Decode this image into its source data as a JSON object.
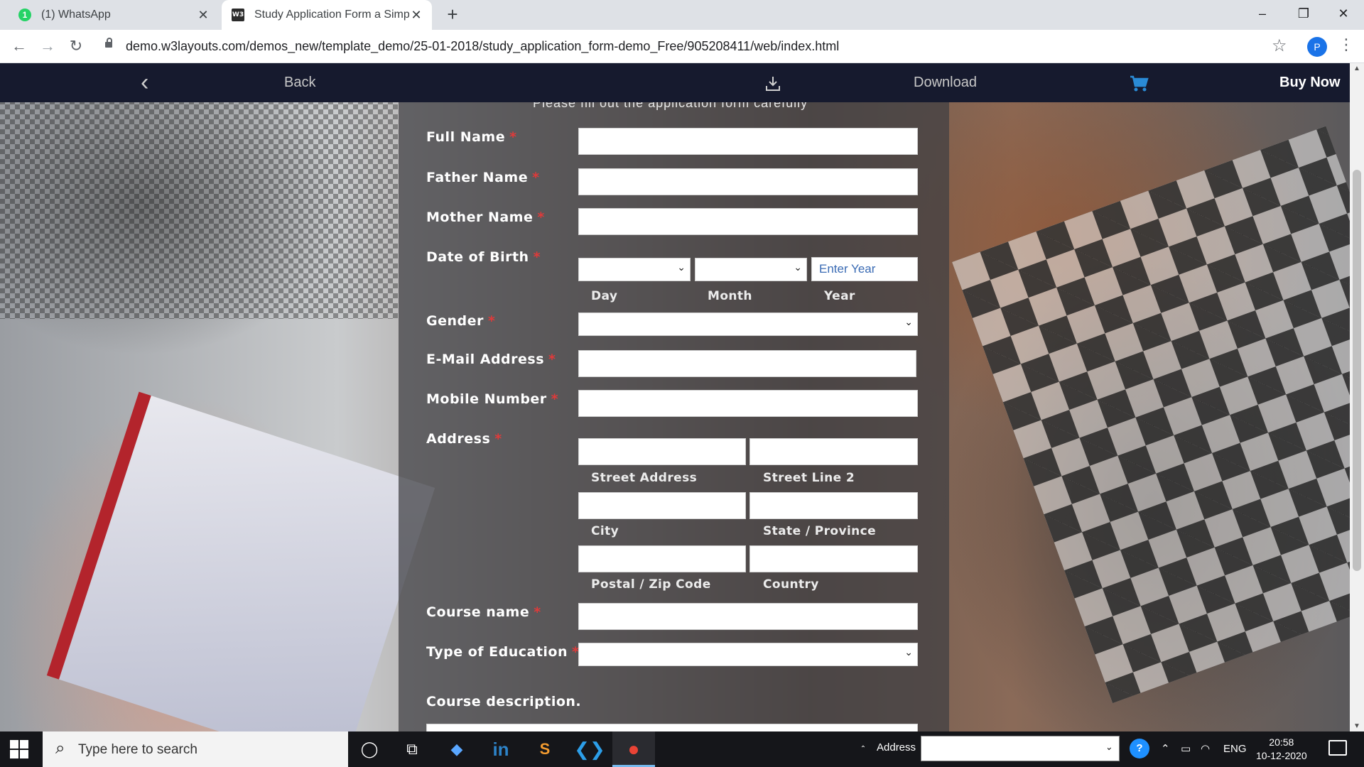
{
  "browser": {
    "tabs": [
      {
        "title": "(1) WhatsApp",
        "icon": "whatsapp-icon",
        "badge": "1"
      },
      {
        "title": "Study Application Form a Simple",
        "icon": "w3layouts-icon",
        "badge": "W3"
      }
    ],
    "new_tab": "+",
    "url": "demo.w3layouts.com/demos_new/template_demo/25-01-2018/study_application_form-demo_Free/905208411/web/index.html",
    "profile_initial": "P"
  },
  "topbar": {
    "back_label": "Back",
    "download_label": "Download",
    "buy_label": "Buy Now"
  },
  "form": {
    "cut_heading": "Please fill out the application form carefully",
    "full_name": "Full Name",
    "father_name": "Father Name",
    "mother_name": "Mother Name",
    "dob": "Date of Birth",
    "year_placeholder": "Enter Year",
    "day": "Day",
    "month": "Month",
    "year": "Year",
    "gender": "Gender",
    "email": "E-Mail Address",
    "mobile": "Mobile Number",
    "address": "Address",
    "street": "Street Address",
    "street2": "Street Line 2",
    "city": "City",
    "state": "State / Province",
    "postal": "Postal / Zip Code",
    "country": "Country",
    "course_name": "Course name",
    "education_type": "Type of Education",
    "course_desc": "Course description.",
    "required_mark": "*"
  },
  "taskbar": {
    "search_placeholder": "Type here to search",
    "address_label": "Address",
    "language": "ENG",
    "time": "20:58",
    "date": "10-12-2020"
  },
  "colors": {
    "topbar_bg": "#161a2e",
    "required": "#e03a3a",
    "cart": "#2a8bd6"
  }
}
